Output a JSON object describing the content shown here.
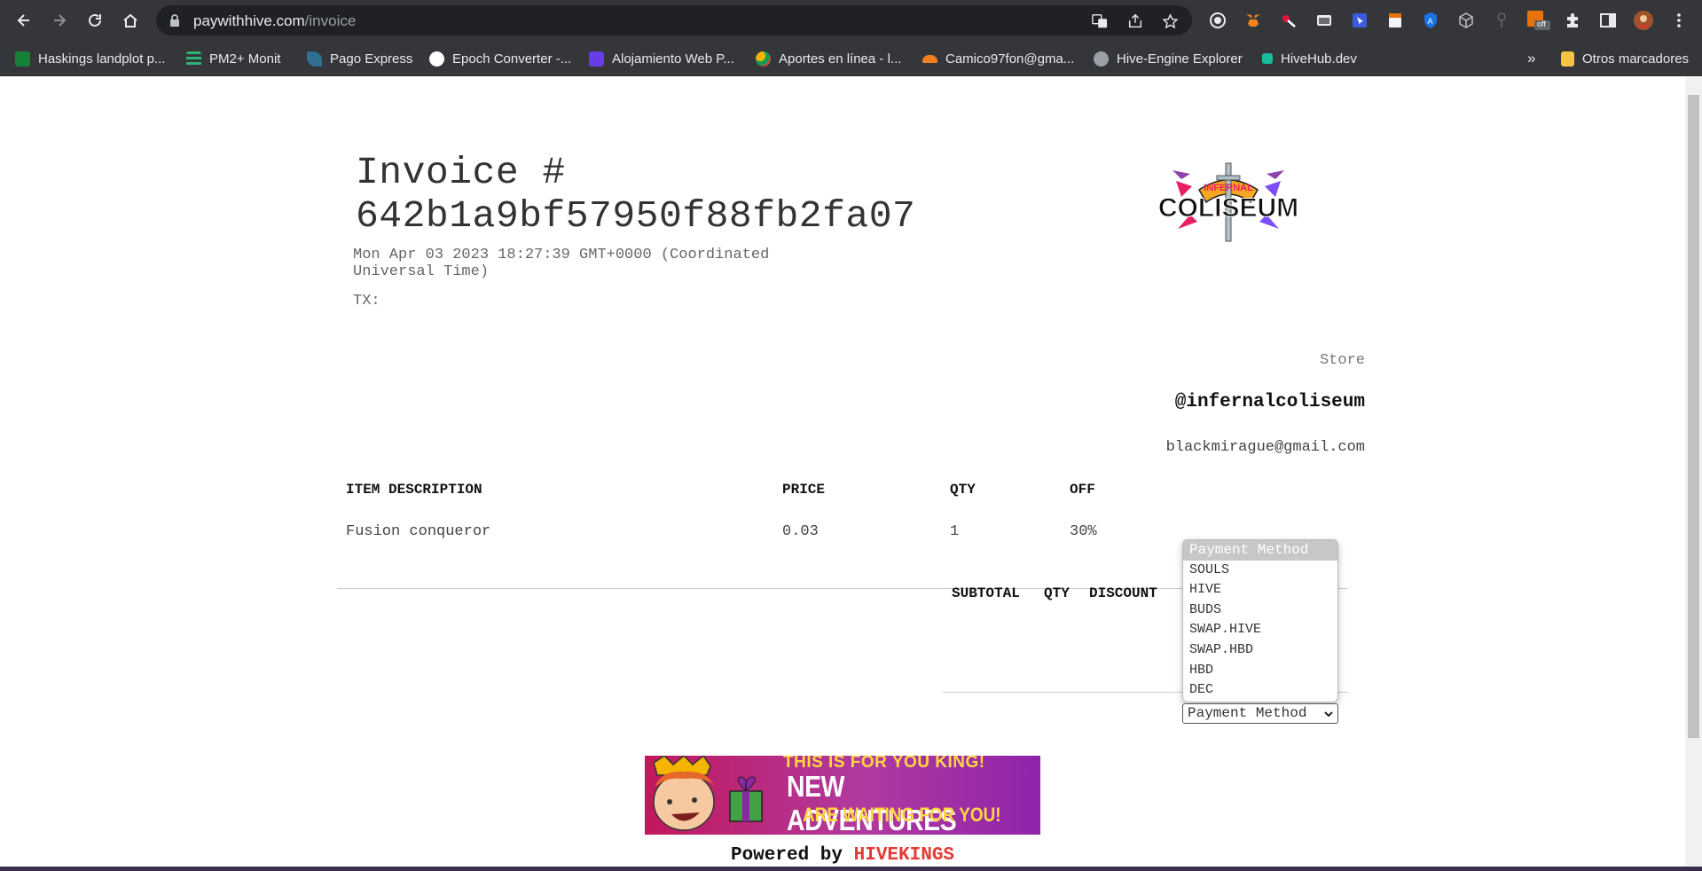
{
  "browser": {
    "url_host": "paywithhive.com",
    "url_path": "/invoice",
    "extension_badge": "off"
  },
  "bookmarks": {
    "items": [
      {
        "label": "Haskings landplot p...",
        "color": "#188038"
      },
      {
        "label": "PM2+ Monit",
        "color": "#2bb673"
      },
      {
        "label": "Pago Express",
        "color": "#3d8fb8"
      },
      {
        "label": "Epoch Converter -...",
        "color": "#ffffff"
      },
      {
        "label": "Alojamiento Web P...",
        "color": "#673de6"
      },
      {
        "label": "Aportes en línea - l...",
        "color": "#f4b400"
      },
      {
        "label": "Camico97fon@gma...",
        "color": "#f38020"
      },
      {
        "label": "Hive-Engine Explorer",
        "color": "#9aa0a6"
      },
      {
        "label": "HiveHub.dev",
        "color": "#1abc9c"
      }
    ],
    "overflow": "»",
    "other": "Otros marcadores"
  },
  "invoice": {
    "title_line1": "Invoice #",
    "title_line2": "642b1a9bf57950f88fb2fa07",
    "date": "Mon Apr 03 2023 18:27:39 GMT+0000 (Coordinated Universal Time)",
    "tx_label": "TX:",
    "logo_text_top": "INFERNAL",
    "logo_text_main": "COLISEUM"
  },
  "store": {
    "label": "Store",
    "handle": "@infernalcoliseum",
    "email": "blackmirague@gmail.com"
  },
  "table": {
    "headers": [
      "ITEM DESCRIPTION",
      "PRICE",
      "QTY",
      "OFF"
    ],
    "rows": [
      [
        "Fusion conqueror",
        "0.03",
        "1",
        "30%"
      ]
    ]
  },
  "summary": {
    "headers": [
      "SUBTOTAL",
      "QTY",
      "DISCOUNT"
    ]
  },
  "payment": {
    "placeholder": "Payment Method",
    "options": [
      "SOULS",
      "HIVE",
      "BUDS",
      "SWAP.HIVE",
      "SWAP.HBD",
      "HBD",
      "DEC"
    ],
    "selected": "Payment Method"
  },
  "banner": {
    "line1": "THIS IS FOR YOU KING!",
    "line2": "NEW ADVENTURES",
    "line3": "ARE WAITING FOR YOU!"
  },
  "footer": {
    "powered_prefix": "Powered by",
    "brand": "HIVEKINGS"
  }
}
